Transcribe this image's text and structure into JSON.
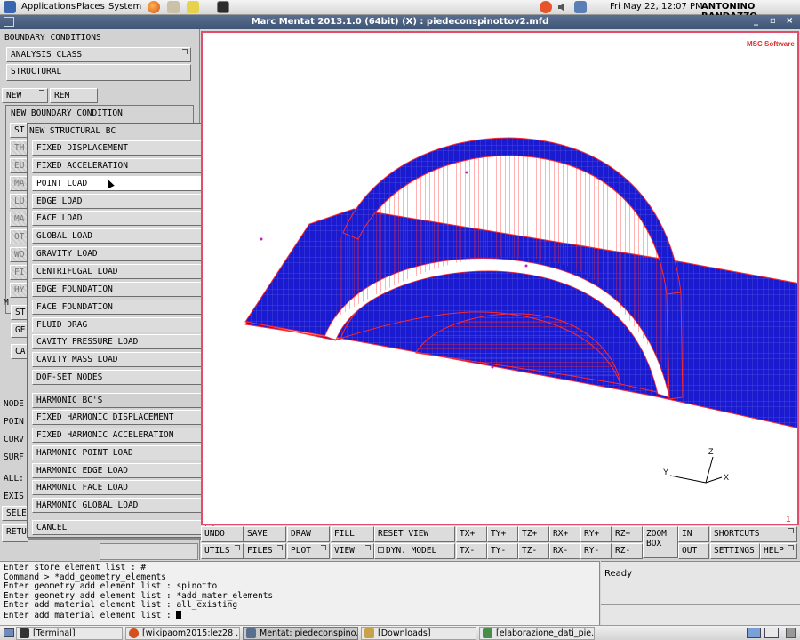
{
  "top_panel": {
    "menus": [
      "Applications",
      "Places",
      "System"
    ],
    "datetime": "Fri May 22, 12:07 PM",
    "user": "ANTONINO RANDAZZO"
  },
  "window": {
    "title": "Marc Mentat 2013.1.0 (64bit) (X) : piedeconspinottov2.mfd",
    "controls": [
      "_",
      "▫",
      "×"
    ]
  },
  "left_panel": {
    "header": "BOUNDARY CONDITIONS",
    "analysis_class": "ANALYSIS CLASS",
    "structural": "STRUCTURAL",
    "new": "NEW",
    "rem": "REM",
    "new_boundary_condition": "NEW BOUNDARY CONDITION",
    "partial_left": [
      "ST",
      "TH",
      "EU",
      "MA",
      "LU",
      "MA",
      "OT",
      "WO",
      "FI",
      "HY"
    ],
    "partial_lower": [
      "M",
      "ST",
      "GE",
      "CA"
    ],
    "bottom_labels": [
      "NODE",
      "POIN",
      "CURV",
      "SURF",
      "ALL:",
      "EXIS",
      "SELE",
      "RETU"
    ]
  },
  "popup": {
    "header": "NEW STRUCTURAL BC",
    "items": [
      "FIXED DISPLACEMENT",
      "FIXED ACCELERATION",
      "POINT LOAD",
      "EDGE LOAD",
      "FACE LOAD",
      "GLOBAL LOAD",
      "GRAVITY LOAD",
      "CENTRIFUGAL LOAD",
      "EDGE FOUNDATION",
      "FACE FOUNDATION",
      "FLUID DRAG",
      "CAVITY PRESSURE LOAD",
      "CAVITY MASS LOAD",
      "DOF-SET NODES"
    ],
    "harmonic_header": "HARMONIC BC'S",
    "harmonic_items": [
      "FIXED HARMONIC DISPLACEMENT",
      "FIXED HARMONIC ACCELERATION",
      "HARMONIC POINT LOAD",
      "HARMONIC EDGE LOAD",
      "HARMONIC FACE LOAD",
      "HARMONIC GLOBAL LOAD"
    ],
    "cancel": "CANCEL"
  },
  "viewport": {
    "logo": "MSC Software",
    "viewport_number": "1",
    "axes": {
      "x": "X",
      "y": "Y",
      "z": "Z"
    },
    "colors": {
      "mesh": "#1a1ad0",
      "edge": "#ff2a2a",
      "border": "#e34d6a"
    }
  },
  "toolbar": {
    "row1": [
      "UNDO",
      "SAVE",
      "DRAW",
      "FILL",
      "RESET VIEW",
      "TX+",
      "TY+",
      "TZ+",
      "RX+",
      "RY+",
      "RZ+",
      "ZOOM BOX",
      "IN",
      "SHORTCUTS"
    ],
    "row2": [
      "UTILS",
      "FILES",
      "PLOT",
      "VIEW",
      "DYN. MODEL",
      "TX-",
      "TY-",
      "TZ-",
      "RX-",
      "RY-",
      "RZ-",
      "OUT",
      "SETTINGS",
      "HELP"
    ]
  },
  "console": {
    "lines": [
      "Enter store element list : #",
      "Command > *add_geometry_elements",
      "Enter geometry add element list : spinotto",
      "Enter geometry add element list : *add_mater_elements",
      "Enter add material element list : all_existing",
      "Enter add material element list : "
    ]
  },
  "status": {
    "text": "Ready"
  },
  "taskbar": {
    "tasks": [
      "[Terminal]",
      "[wikipaom2015:lez28 ...",
      "Mentat: piedeconspino...",
      "[Downloads]",
      "[elaborazione_dati_pie..."
    ]
  }
}
